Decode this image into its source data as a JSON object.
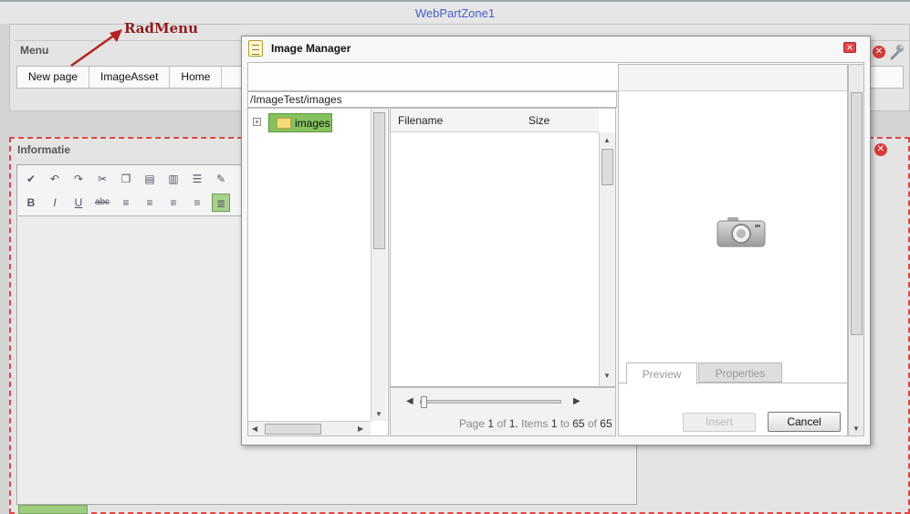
{
  "page": {
    "zone_title": "WebPartZone1",
    "callout": "RadMenu"
  },
  "menu_part": {
    "title": "Menu",
    "items": [
      {
        "label": "New page"
      },
      {
        "label": "ImageAsset"
      },
      {
        "label": "Home"
      }
    ]
  },
  "info_part": {
    "title": "Informatie"
  },
  "editor": {
    "toolbar_1": [
      "spellcheck-icon",
      "undo-icon",
      "redo-icon",
      "cut-icon",
      "copy-icon",
      "paste-icon",
      "paste-special-icon",
      "list-icon",
      "format-painter-icon"
    ],
    "toolbar_2": [
      {
        "icon": "bold-icon",
        "glyph": "B"
      },
      {
        "icon": "italic-icon",
        "glyph": "I"
      },
      {
        "icon": "underline-icon",
        "glyph": "U"
      },
      {
        "icon": "strikethrough-icon",
        "glyph": "abc"
      }
    ]
  },
  "dialog": {
    "title": "Image Manager",
    "path": "/ImageTest/images",
    "tree": {
      "root_label": "images",
      "expander": "+"
    },
    "grid": {
      "columns": [
        "Filename",
        "Size"
      ]
    },
    "pager": {
      "prefix": "Page",
      "page": "1",
      "of_label": "of",
      "page_count": "1.",
      "items_label": "Items",
      "from": "1",
      "to_label": "to",
      "to": "65",
      "of_label_2": "of",
      "total": "65"
    },
    "tabs": {
      "preview": "Preview",
      "properties": "Properties"
    },
    "buttons": {
      "insert": "Insert",
      "cancel": "Cancel"
    }
  },
  "colors": {
    "zone_title": "#4a5ccd",
    "callout": "#8e1d1d",
    "selection_green": "#86c25f",
    "close_red": "#d83a3a",
    "dashed_border": "#e04646"
  }
}
